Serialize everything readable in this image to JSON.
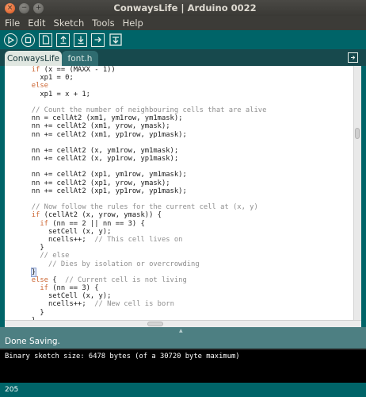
{
  "window": {
    "title": "ConwaysLife | Arduino 0022"
  },
  "menu": [
    "File",
    "Edit",
    "Sketch",
    "Tools",
    "Help"
  ],
  "toolbar": {
    "buttons": [
      "verify-button",
      "stop-button",
      "new-button",
      "open-button",
      "save-button",
      "upload-button",
      "serial-monitor-button"
    ]
  },
  "tabs": [
    {
      "label": "ConwaysLife",
      "active": true
    },
    {
      "label": "font.h",
      "active": false
    }
  ],
  "code": {
    "lines": [
      "      if (x == (MAXX - 1))",
      "        xp1 = 0;",
      "      else",
      "        xp1 = x + 1;",
      "",
      "      // Count the number of neighbouring cells that are alive",
      "      nn = cellAt2 (xm1, ym1row, ym1mask);",
      "      nn += cellAt2 (xm1, yrow, ymask);",
      "      nn += cellAt2 (xm1, yp1row, yp1mask);",
      "",
      "      nn += cellAt2 (x, ym1row, ym1mask);",
      "      nn += cellAt2 (x, yp1row, yp1mask);",
      "",
      "      nn += cellAt2 (xp1, ym1row, ym1mask);",
      "      nn += cellAt2 (xp1, yrow, ymask);",
      "      nn += cellAt2 (xp1, yp1row, yp1mask);",
      "",
      "      // Now follow the rules for the current cell at (x, y)",
      "      if (cellAt2 (x, yrow, ymask)) {",
      "        if (nn == 2 || nn == 3) {",
      "          setCell (x, y);",
      "          ncells++;  // This cell lives on",
      "        }",
      "        // else",
      "          // Dies by isolation or overcrowding",
      "      }",
      "      else {  // Current cell is not living",
      "        if (nn == 3) {",
      "          setCell (x, y);",
      "          ncells++;  // New cell is born",
      "        }",
      "      }"
    ]
  },
  "status": {
    "message": "Done Saving."
  },
  "console": {
    "message": "Binary sketch size: 6478 bytes (of a 30720 byte maximum)"
  },
  "footer": {
    "line_number": "205"
  },
  "colors": {
    "teal": "#006468",
    "keyword": "#cc6633",
    "comment": "#8e8e8e"
  }
}
